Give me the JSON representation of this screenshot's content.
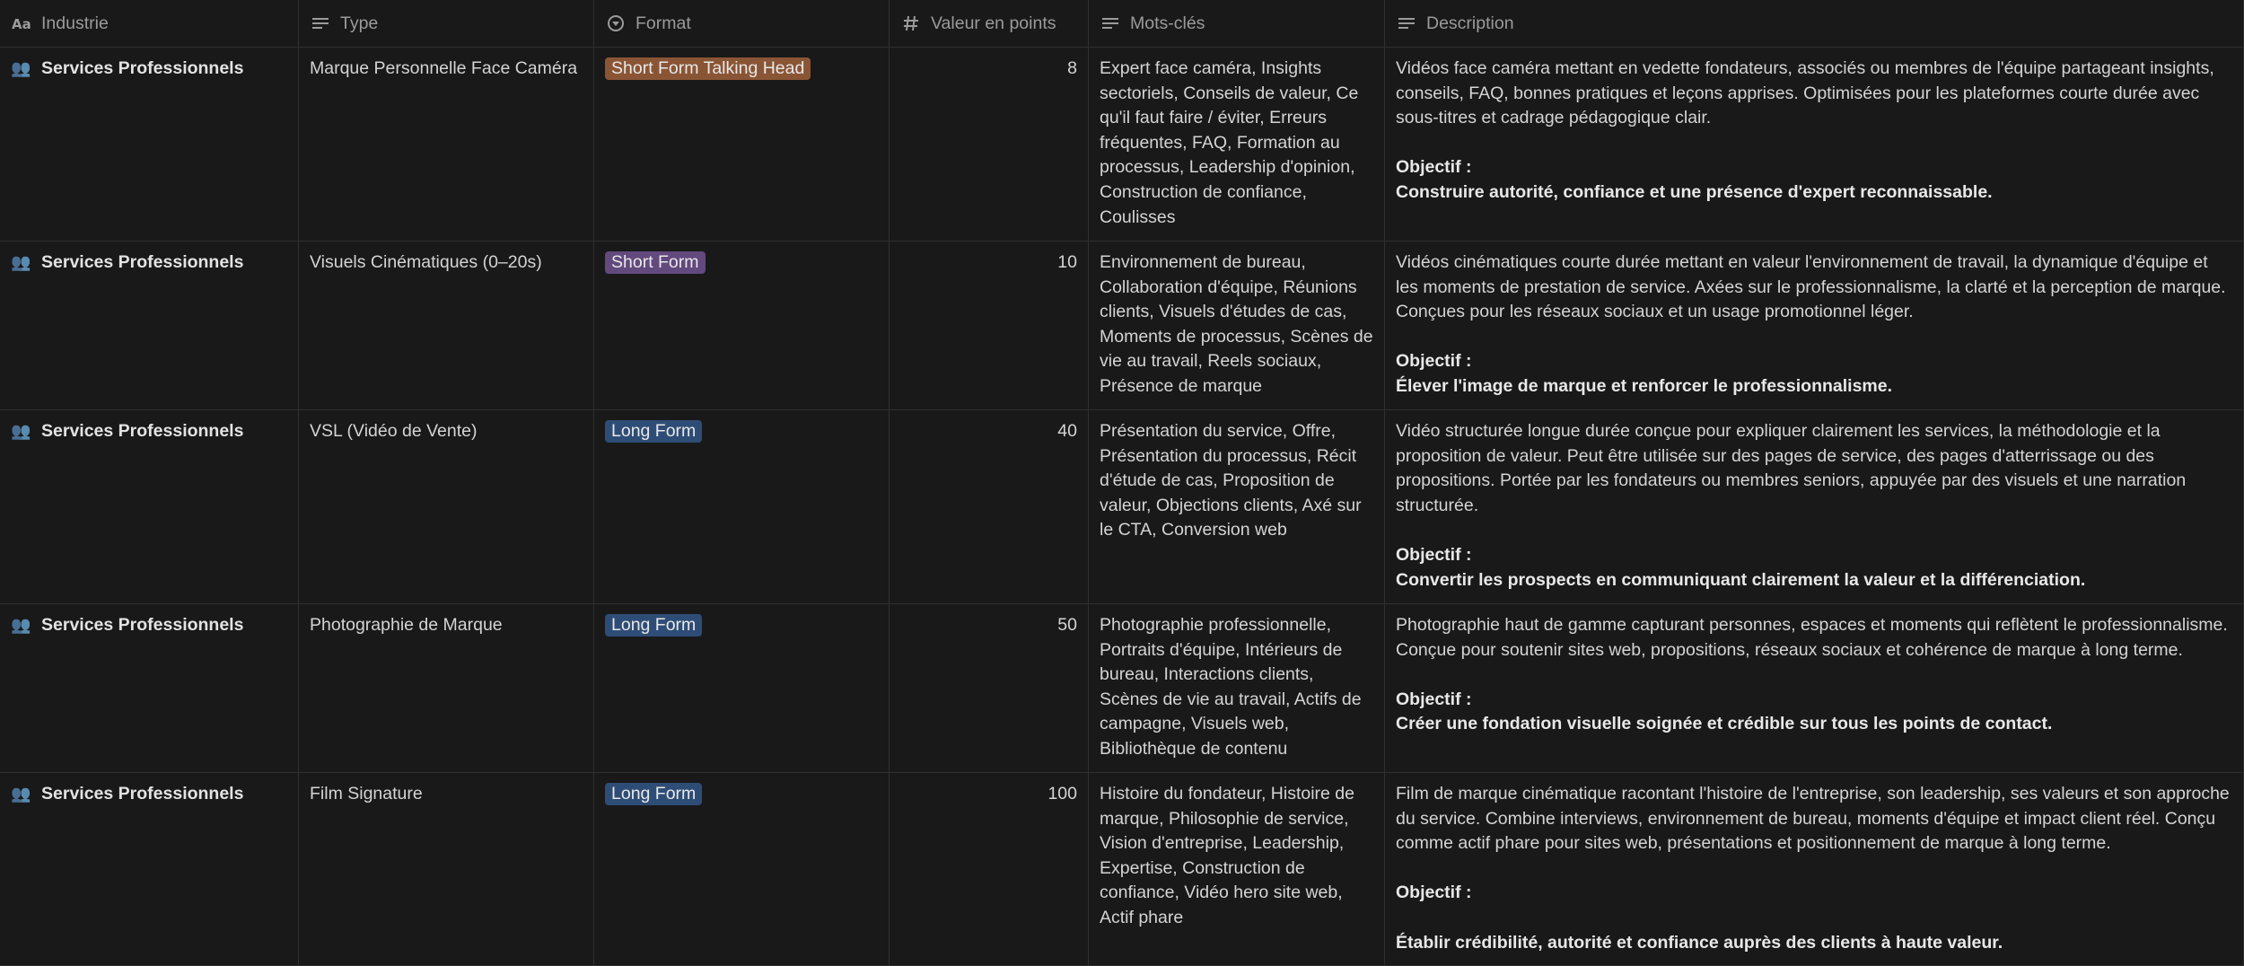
{
  "columns": [
    {
      "label": "Industrie",
      "icon": "title-aa-icon"
    },
    {
      "label": "Type",
      "icon": "text-lines-icon"
    },
    {
      "label": "Format",
      "icon": "select-circle-icon"
    },
    {
      "label": "Valeur en points",
      "icon": "number-hash-icon"
    },
    {
      "label": "Mots-clés",
      "icon": "text-lines-icon"
    },
    {
      "label": "Description",
      "icon": "text-lines-icon"
    }
  ],
  "rows": [
    {
      "industry": "Services Professionnels",
      "type": "Marque Personnelle Face Caméra",
      "format": "Short Form Talking Head",
      "format_color": "#8a5535",
      "points": "8",
      "keywords": "Expert face caméra, Insights sectoriels, Conseils de valeur, Ce qu'il faut faire / éviter, Erreurs fréquentes, FAQ, Formation au processus, Leadership d'opinion, Construction de confiance, Coulisses",
      "description": "Vidéos face caméra mettant en vedette fondateurs, associés ou membres de l'équipe partageant insights, conseils, FAQ, bonnes pratiques et leçons apprises. Optimisées pour les plateformes courte durée avec sous-titres et cadrage pédagogique clair.",
      "objective_label": "Objectif :",
      "objective": "Construire autorité, confiance et une présence d'expert reconnaissable."
    },
    {
      "industry": "Services Professionnels",
      "type": "Visuels Cinématiques (0–20s)",
      "format": "Short Form",
      "format_color": "#62497e",
      "points": "10",
      "keywords": "Environnement de bureau, Collaboration d'équipe, Réunions clients, Visuels d'études de cas, Moments de processus, Scènes de vie au travail, Reels sociaux, Présence de marque",
      "description": "Vidéos cinématiques courte durée mettant en valeur l'environnement de travail, la dynamique d'équipe et les moments de prestation de service. Axées sur le professionnalisme, la clarté et la perception de marque. Conçues pour les réseaux sociaux et un usage promotionnel léger.",
      "objective_label": "Objectif :",
      "objective": "Élever l'image de marque et renforcer le professionnalisme."
    },
    {
      "industry": "Services Professionnels",
      "type": "VSL (Vidéo de Vente)",
      "format": "Long Form",
      "format_color": "#2e4d76",
      "points": "40",
      "keywords": "Présentation du service, Offre, Présentation du processus, Récit d'étude de cas, Proposition de valeur, Objections clients, Axé sur le CTA, Conversion web",
      "description": "Vidéo structurée longue durée conçue pour expliquer clairement les services, la méthodologie et la proposition de valeur. Peut être utilisée sur des pages de service, des pages d'atterrissage ou des propositions. Portée par les fondateurs ou membres seniors, appuyée par des visuels et une narration structurée.",
      "objective_label": "Objectif :",
      "objective": "Convertir les prospects en communiquant clairement la valeur et la différenciation."
    },
    {
      "industry": "Services Professionnels",
      "type": "Photographie de Marque",
      "format": "Long Form",
      "format_color": "#2e4d76",
      "points": "50",
      "keywords": "Photographie professionnelle, Portraits d'équipe, Intérieurs de bureau, Interactions clients, Scènes de vie au travail, Actifs de campagne, Visuels web, Bibliothèque de contenu",
      "description": "Photographie haut de gamme capturant personnes, espaces et moments qui reflètent le professionnalisme. Conçue pour soutenir sites web, propositions, réseaux sociaux et cohérence de marque à long terme.",
      "objective_label": "Objectif :",
      "objective": "Créer une fondation visuelle soignée et crédible sur tous les points de contact."
    },
    {
      "industry": "Services Professionnels",
      "type": "Film Signature",
      "format": "Long Form",
      "format_color": "#2e4d76",
      "points": "100",
      "keywords": "Histoire du fondateur, Histoire de marque, Philosophie de service, Vision d'entreprise, Leadership, Expertise, Construction de confiance, Vidéo hero site web, Actif phare",
      "description": "Film de marque cinématique racontant l'histoire de l'entreprise, son leadership, ses valeurs et son approche du service. Combine interviews, environnement de bureau, moments d'équipe et impact client réel. Conçu comme actif phare pour sites web, présentations et positionnement de marque à long terme.",
      "objective_label": "Objectif :",
      "objective": "Établir crédibilité, autorité et confiance auprès des clients à haute valeur."
    }
  ]
}
